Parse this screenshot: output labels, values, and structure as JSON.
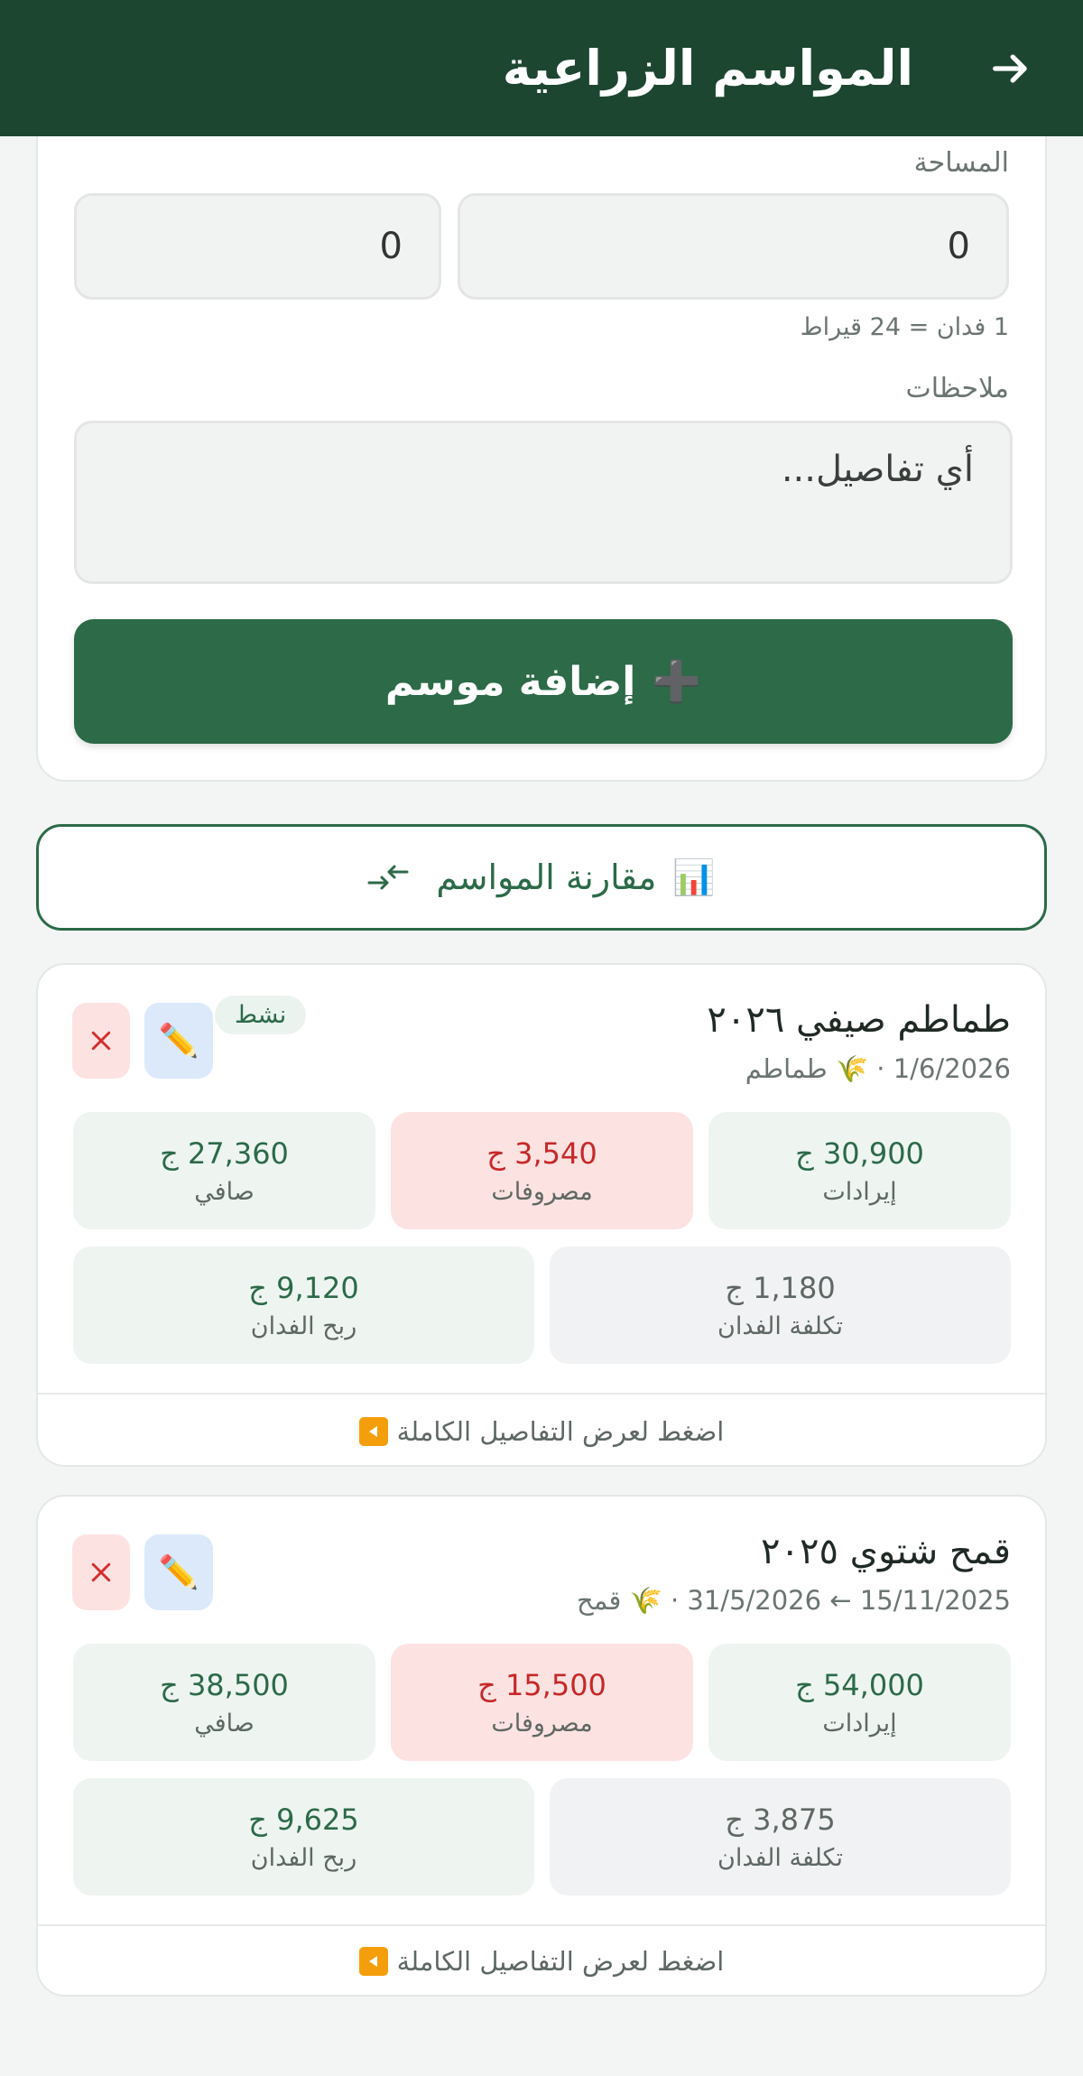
{
  "header": {
    "title": "المواسم الزراعية",
    "back_icon": "arrow-back-icon"
  },
  "form": {
    "area_label": "المساحة",
    "area_feddan_value": "0",
    "area_qirat_value": "0",
    "area_hint": "1 فدان = 24 قيراط",
    "notes_label": "ملاحظات",
    "notes_placeholder": "أي تفاصيل...",
    "add_button_icon": "➕",
    "add_button_label": "إضافة موسم"
  },
  "compare": {
    "icon": "📊",
    "label": "مقارنة المواسم",
    "arrows_icon": "compare-arrows-icon"
  },
  "seasons": [
    {
      "title": "طماطم صيفي ٢٠٢٦",
      "meta": "1/6/2026 · 🌾 طماطم",
      "status": "نشط",
      "revenue_value": "30,900 ج",
      "revenue_label": "إيرادات",
      "expenses_value": "3,540 ج",
      "expenses_label": "مصروفات",
      "net_value": "27,360 ج",
      "net_label": "صافي",
      "cost_per_feddan_value": "1,180 ج",
      "cost_per_feddan_label": "تكلفة الفدان",
      "profit_per_feddan_value": "9,120 ج",
      "profit_per_feddan_label": "ربح الفدان",
      "details_label": "اضغط لعرض التفاصيل الكاملة"
    },
    {
      "title": "قمح شتوي ٢٠٢٥",
      "meta": "15/11/2025 ← 31/5/2026 · 🌾 قمح",
      "revenue_value": "54,000 ج",
      "revenue_label": "إيرادات",
      "expenses_value": "15,500 ج",
      "expenses_label": "مصروفات",
      "net_value": "38,500 ج",
      "net_label": "صافي",
      "cost_per_feddan_value": "3,875 ج",
      "cost_per_feddan_label": "تكلفة الفدان",
      "profit_per_feddan_value": "9,625 ج",
      "profit_per_feddan_label": "ربح الفدان",
      "details_label": "اضغط لعرض التفاصيل الكاملة"
    }
  ],
  "colors": {
    "primary": "#1d4631",
    "accent": "#2c6a48",
    "danger": "#c62828",
    "details_icon": "#f59e0b"
  }
}
